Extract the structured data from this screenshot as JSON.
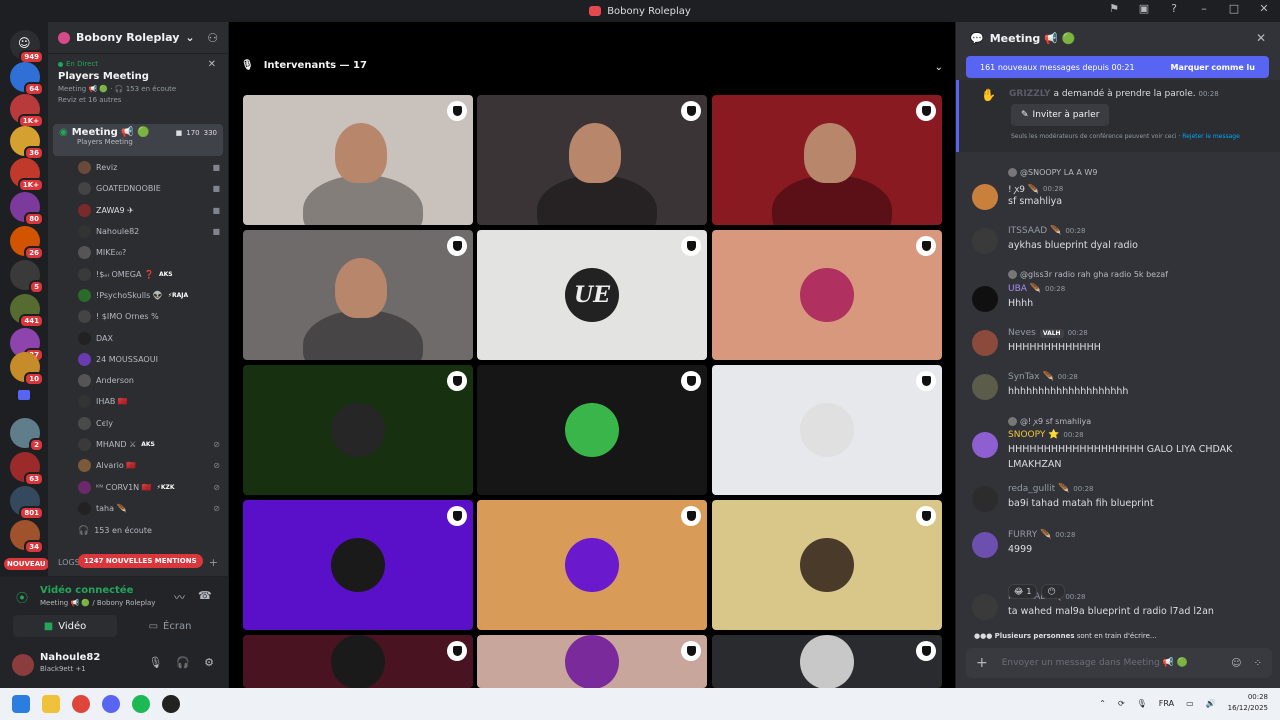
{
  "window": {
    "title": "Bobony Roleplay"
  },
  "rail": {
    "home_badge": "949",
    "badges": [
      "64",
      "1K+",
      "36",
      "1K+",
      "80",
      "26",
      "5",
      "441",
      "37",
      "10",
      "2",
      "63",
      "801",
      "34"
    ],
    "new_label": "NOUVEAU"
  },
  "sidebar": {
    "server_name": "Bobony Roleplay",
    "event": {
      "live_label": "En Direct",
      "title": "Players Meeting",
      "meta": "Meeting 📢 🟢 · 🎧 153 en écoute",
      "sub": "Reviz et 16 autres"
    },
    "voice_channel": {
      "name": "Meeting 📢 🟢",
      "sub": "Players Meeting",
      "video_count": "170",
      "listen_count": "330"
    },
    "members": [
      {
        "name": "Reviz",
        "tag": "",
        "color": "#b5bac1",
        "icon": "video"
      },
      {
        "name": "GOATEDNOOBIE",
        "tag": "",
        "color": "#b5bac1",
        "icon": "video"
      },
      {
        "name": "ZAWA9 ✈",
        "tag": "",
        "color": "#dbdee1",
        "icon": "video"
      },
      {
        "name": "Nahoule82",
        "tag": "",
        "color": "#b5bac1",
        "icon": "video"
      },
      {
        "name": "MIKE₀₀?",
        "tag": "",
        "color": "#b5bac1",
        "icon": ""
      },
      {
        "name": "!$ₑₗ OMEGA ❓",
        "tag": "AKS",
        "color": "#b5bac1",
        "icon": ""
      },
      {
        "name": "!PsychoSkulls 👽",
        "tag": "⚡RAJA",
        "color": "#b5bac1",
        "icon": ""
      },
      {
        "name": "! $IMO Ornes %",
        "tag": "",
        "color": "#b5bac1",
        "icon": ""
      },
      {
        "name": "DAX",
        "tag": "",
        "color": "#b5bac1",
        "icon": ""
      },
      {
        "name": "24 MOUSSAOUI",
        "tag": "",
        "color": "#b5bac1",
        "icon": ""
      },
      {
        "name": "Anderson",
        "tag": "",
        "color": "#b5bac1",
        "icon": ""
      },
      {
        "name": "IHAB 🇲🇦",
        "tag": "",
        "color": "#b5bac1",
        "icon": ""
      },
      {
        "name": "Cєly",
        "tag": "",
        "color": "#b5bac1",
        "icon": ""
      },
      {
        "name": "MHAND ⚔",
        "tag": "AKS",
        "color": "#b5bac1",
        "icon": "muted"
      },
      {
        "name": "Alvario 🇲🇦",
        "tag": "",
        "color": "#b5bac1",
        "icon": "muted"
      },
      {
        "name": "ᴷᴺ CORV1N 🇲🇦",
        "tag": "⚡KZK",
        "color": "#b5bac1",
        "icon": "muted"
      },
      {
        "name": "taha 🪶",
        "tag": "",
        "color": "#b5bac1",
        "icon": "muted"
      }
    ],
    "listening": "153 en écoute",
    "logs_label": "LOGS",
    "mentions": "1247 NOUVELLES MENTIONS"
  },
  "voice_panel": {
    "status": "Vidéo connectée",
    "location": "Meeting 📢 🟢 / Bobony Roleplay",
    "video_button": "Vidéo",
    "screen_button": "Écran"
  },
  "user_panel": {
    "name": "Nahoule82",
    "status": "Black9ett +1"
  },
  "stage": {
    "header": "Intervenants — 17",
    "tiles": [
      {
        "kind": "cam",
        "bg": "#c9c2bc",
        "label": ""
      },
      {
        "kind": "cam",
        "bg": "#3b3436",
        "label": ""
      },
      {
        "kind": "cam",
        "bg": "#8a1a22",
        "label": ""
      },
      {
        "kind": "cam",
        "bg": "#6e6b6a",
        "label": ""
      },
      {
        "kind": "logo",
        "bg": "#e3e3e1",
        "label": "UE"
      },
      {
        "kind": "avatar",
        "bg": "#d7987d",
        "label": ""
      },
      {
        "kind": "avatar",
        "bg": "#17300f",
        "label": ""
      },
      {
        "kind": "avatar",
        "bg": "#161616",
        "label": ""
      },
      {
        "kind": "avatar",
        "bg": "#e6e8ec",
        "label": ""
      },
      {
        "kind": "avatar",
        "bg": "#5a10c8",
        "label": ""
      },
      {
        "kind": "avatar",
        "bg": "#d99c58",
        "label": ""
      },
      {
        "kind": "avatar",
        "bg": "#d9c78a",
        "label": ""
      },
      {
        "kind": "avatar",
        "bg": "#4a1322",
        "label": ""
      },
      {
        "kind": "avatar",
        "bg": "#c9a69c",
        "label": ""
      },
      {
        "kind": "avatar",
        "bg": "#2a2b2f",
        "label": ""
      }
    ]
  },
  "chat": {
    "channel": "Meeting 📢 🟢",
    "new_bar": {
      "text": "161 nouveaux messages depuis 00:21",
      "action": "Marquer comme lu"
    },
    "request": {
      "user": "GRIZZLY",
      "text": "a demandé à prendre la parole.",
      "time": "00:28",
      "invite": "Inviter à parler",
      "note": "Seuls les modérateurs de conférence peuvent voir ceci ·",
      "reject": "Rejeter le message"
    },
    "messages": [
      {
        "reply": "@SNOOPY LA A W9",
        "user": "! ꭗ9 🪶",
        "time": "00:28",
        "color": "#dbdee1",
        "tag": "",
        "text": "sf smahliya",
        "avatar": "#c9803c"
      },
      {
        "reply": "",
        "user": "ITSSAAD 🪶",
        "time": "00:28",
        "color": "#949ba4",
        "tag": "",
        "text": "aykhas blueprint dyal radio",
        "avatar": "#3a3a3a"
      },
      {
        "reply": "@glss3r radio rah gha radio 5k bezaf",
        "user": "UBA 🪶",
        "time": "00:28",
        "color": "#a98cf5",
        "tag": "",
        "text": "Hhhh",
        "avatar": "#101010"
      },
      {
        "reply": "",
        "user": "Neves",
        "time": "00:28",
        "color": "#949ba4",
        "tag": "VALH",
        "text": "HHHHHHHHHHHHH",
        "avatar": "#8b4a3c"
      },
      {
        "reply": "",
        "user": "SynTax 🪶",
        "time": "00:28",
        "color": "#949ba4",
        "tag": "",
        "text": "hhhhhhhhhhhhhhhhhhhh",
        "avatar": "#5c5c4a"
      },
      {
        "reply": "@! ꭗ9 sf smahliya",
        "user": "SNOOPY ⭐",
        "time": "00:28",
        "color": "#f0c63c",
        "tag": "",
        "text": "HHHHHHHHHHHHHHHHHHH GALO LIYA CHDAK LMAKHZAN",
        "avatar": "#8e5fd0"
      },
      {
        "reply": "",
        "user": "reda_gullit 🪶",
        "time": "00:28",
        "color": "#949ba4",
        "tag": "",
        "text": "ba9i tahad matah fih blueprint",
        "avatar": "#2c2c2c"
      },
      {
        "reply": "",
        "user": "FURRY 🪶",
        "time": "00:28",
        "color": "#949ba4",
        "tag": "",
        "text": "4999",
        "avatar": "#6d4fb0"
      },
      {
        "reply": "",
        "user": "ITSSAAD 🪶",
        "time": "00:28",
        "color": "#949ba4",
        "tag": "",
        "text": "ta wahed mal9a blueprint d radio l7ad l2an",
        "avatar": "#3a3a3a"
      }
    ],
    "reactions": [
      {
        "emoji": "😂",
        "count": "1"
      },
      {
        "emoji": "😶",
        "count": ""
      }
    ],
    "typing": {
      "who": "Plusieurs personnes",
      "rest": "sont en train d'écrire..."
    },
    "composer_placeholder": "Envoyer un message dans Meeting 📢 🟢"
  },
  "taskbar": {
    "lang": "FRA",
    "time": "00:28",
    "date": "16/12/2025"
  }
}
